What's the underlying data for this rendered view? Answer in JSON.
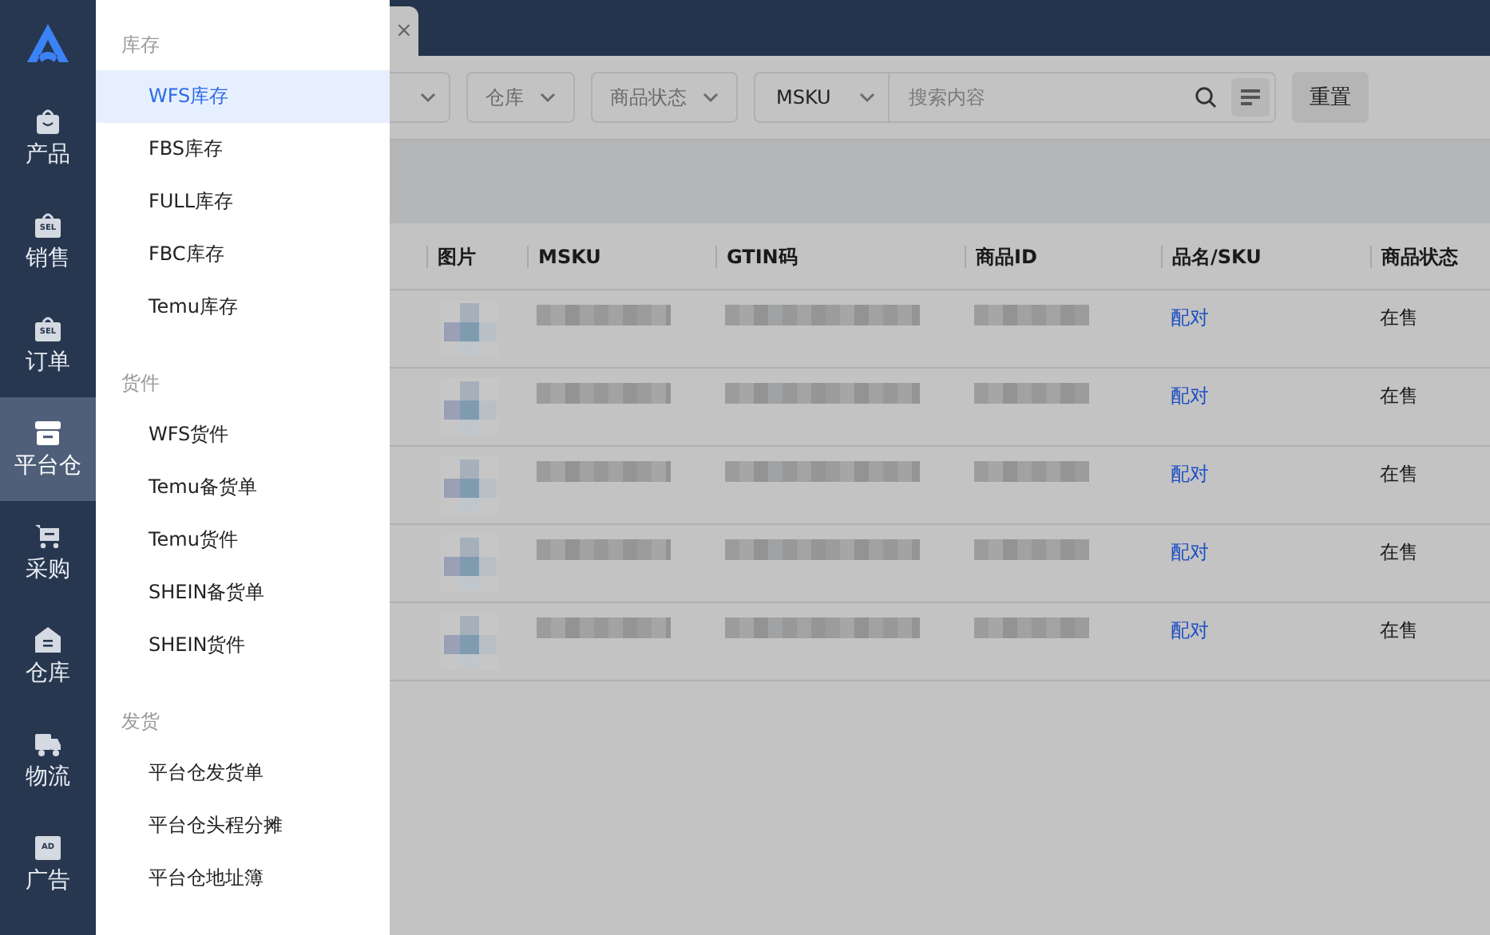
{
  "rail": {
    "items": [
      {
        "kind": "bag",
        "label": "产品",
        "selected": false
      },
      {
        "kind": "tag",
        "badge": "SEL",
        "label": "销售",
        "selected": false
      },
      {
        "kind": "tag",
        "badge": "SEL",
        "label": "订单",
        "selected": false
      },
      {
        "kind": "box",
        "label": "平台仓",
        "selected": true
      },
      {
        "kind": "cart",
        "label": "采购",
        "selected": false
      },
      {
        "kind": "house",
        "label": "仓库",
        "selected": false
      },
      {
        "kind": "truck",
        "label": "物流",
        "selected": false
      },
      {
        "kind": "ad",
        "badge": "AD",
        "label": "广告",
        "selected": false
      }
    ]
  },
  "drawer": {
    "sections": [
      {
        "title": "库存",
        "items": [
          {
            "label": "WFS库存",
            "selected": true
          },
          {
            "label": "FBS库存",
            "selected": false
          },
          {
            "label": "FULL库存",
            "selected": false
          },
          {
            "label": "FBC库存",
            "selected": false
          },
          {
            "label": "Temu库存",
            "selected": false
          }
        ]
      },
      {
        "title": "货件",
        "items": [
          {
            "label": "WFS货件",
            "selected": false
          },
          {
            "label": "Temu备货单",
            "selected": false
          },
          {
            "label": "Temu货件",
            "selected": false
          },
          {
            "label": "SHEIN备货单",
            "selected": false
          },
          {
            "label": "SHEIN货件",
            "selected": false
          }
        ]
      },
      {
        "title": "发货",
        "items": [
          {
            "label": "平台仓发货单",
            "selected": false
          },
          {
            "label": "平台仓头程分摊",
            "selected": false
          },
          {
            "label": "平台仓地址簿",
            "selected": false
          }
        ]
      }
    ]
  },
  "tab": {
    "close": "×"
  },
  "filters": [
    {
      "label": "仓库"
    },
    {
      "label": "商品状态"
    }
  ],
  "search": {
    "field": "MSKU",
    "placeholder": "搜索内容"
  },
  "reset_button": "重置",
  "table": {
    "columns": [
      "图片",
      "MSKU",
      "GTIN码",
      "商品ID",
      "品名/SKU",
      "商品状态"
    ],
    "rows": [
      {
        "link": "配对",
        "status": "在售"
      },
      {
        "link": "配对",
        "status": "在售"
      },
      {
        "link": "配对",
        "status": "在售"
      },
      {
        "link": "配对",
        "status": "在售"
      },
      {
        "link": "配对",
        "status": "在售"
      }
    ]
  }
}
